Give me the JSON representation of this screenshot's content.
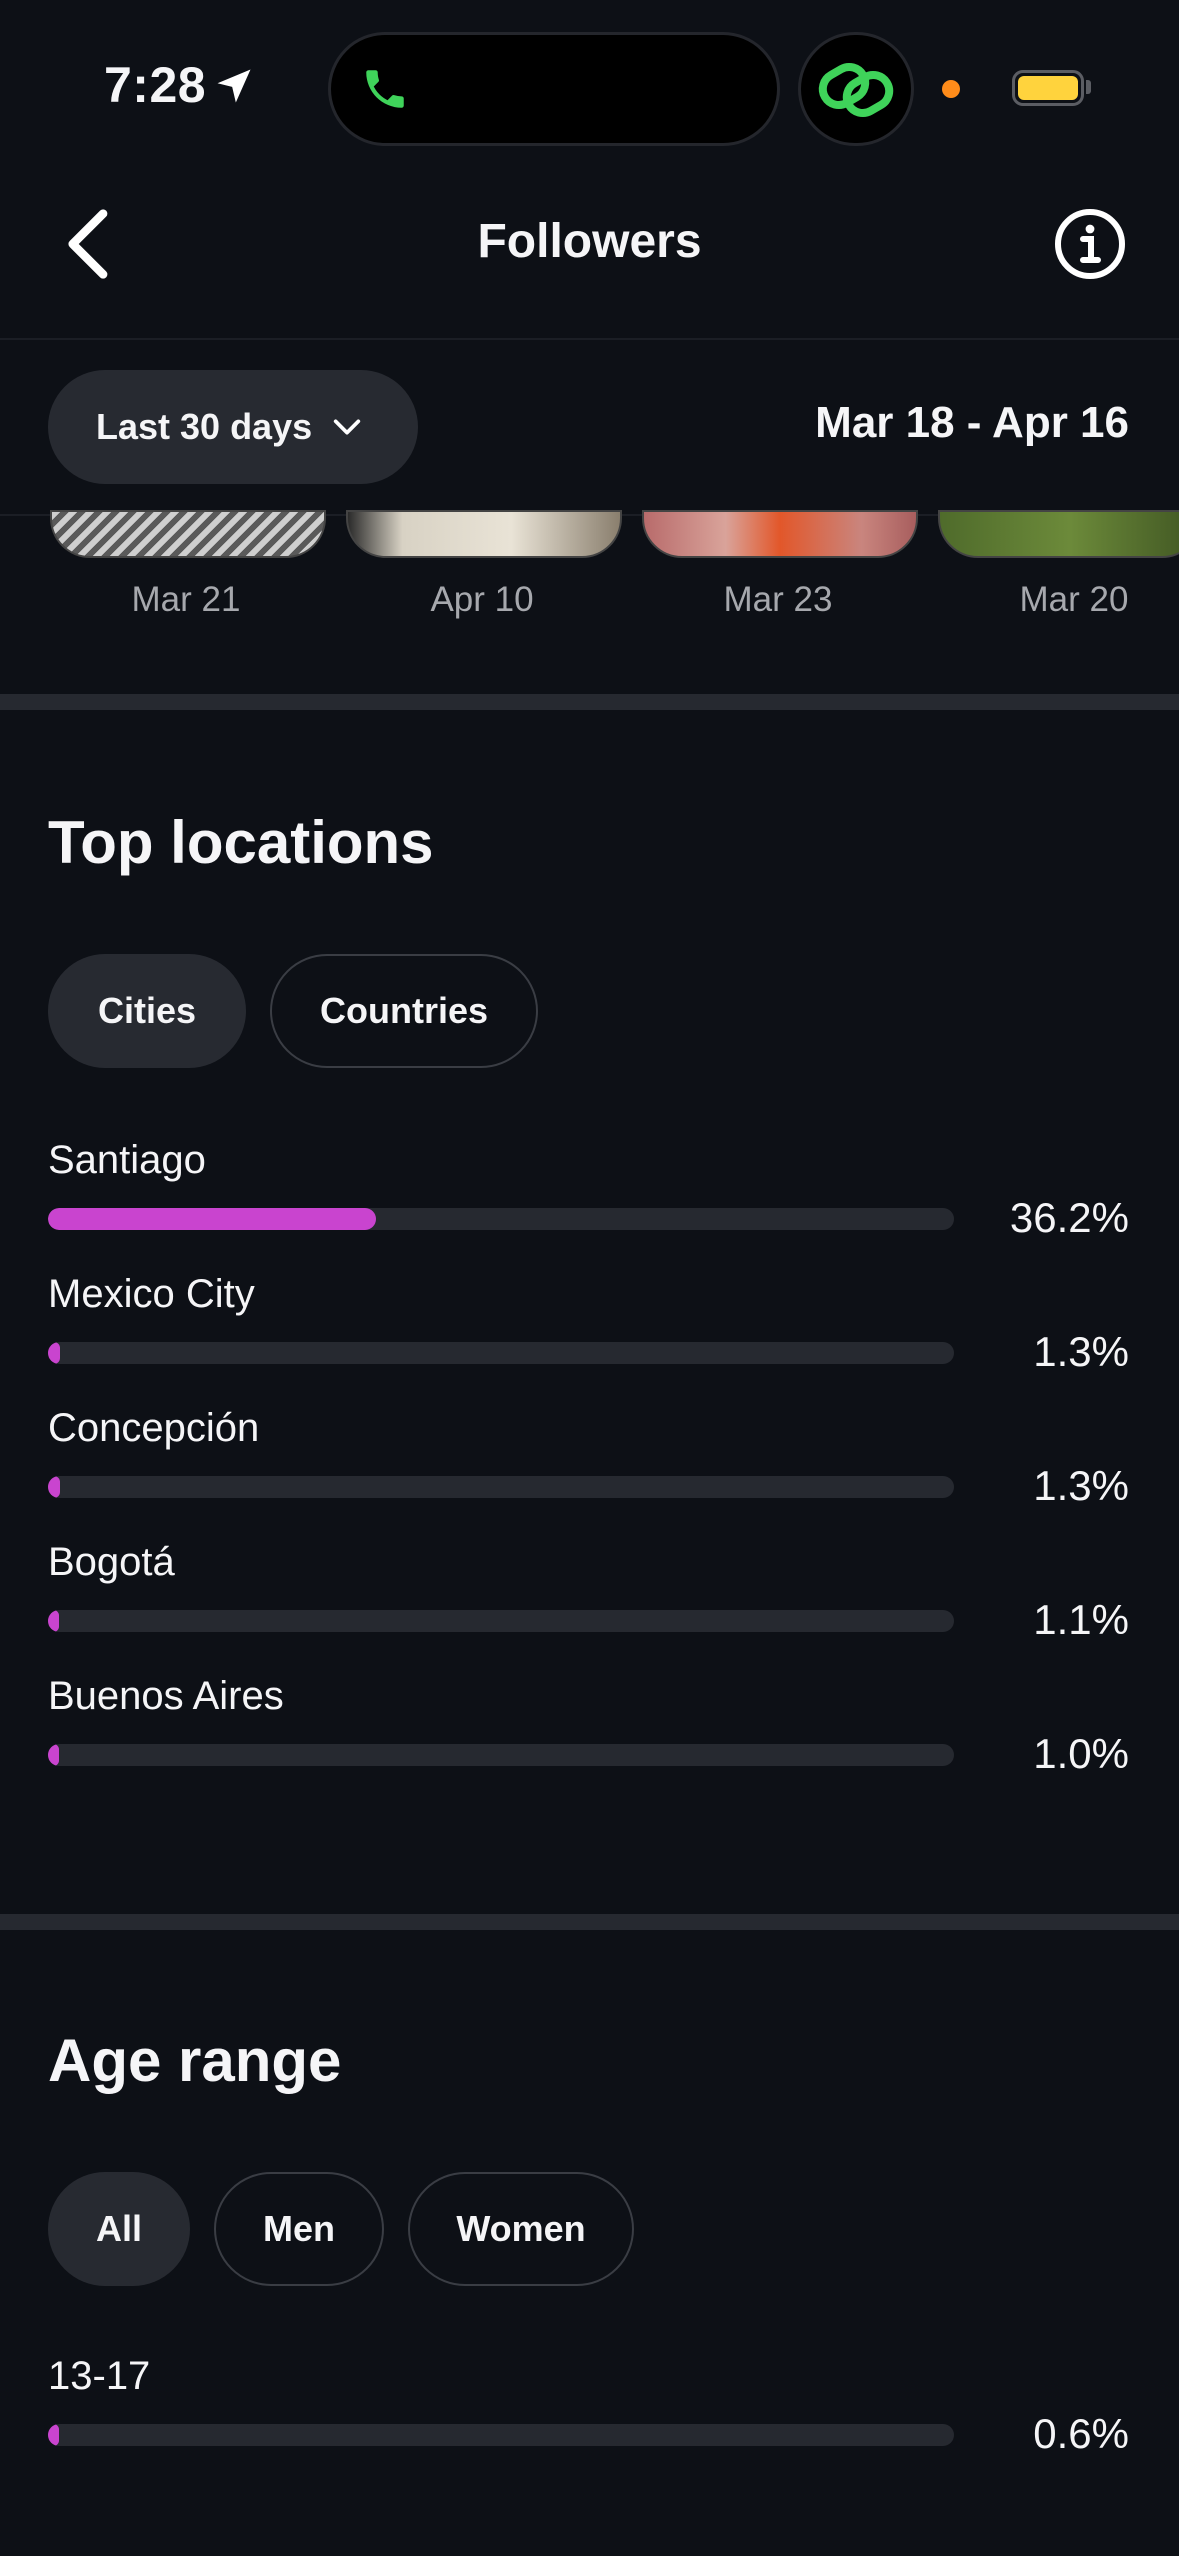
{
  "status_bar": {
    "time": "7:28"
  },
  "header": {
    "title": "Followers"
  },
  "filter": {
    "range_label": "Last 30 days",
    "date_range": "Mar 18 - Apr 16"
  },
  "thumbnails": [
    {
      "date": "Mar 21"
    },
    {
      "date": "Apr 10"
    },
    {
      "date": "Mar 23"
    },
    {
      "date": "Mar 20"
    }
  ],
  "top_locations": {
    "title": "Top locations",
    "tabs": [
      "Cities",
      "Countries"
    ],
    "active_tab": "Cities",
    "rows": [
      {
        "label": "Santiago",
        "percent": "36.2%",
        "value": 0.362
      },
      {
        "label": "Mexico City",
        "percent": "1.3%",
        "value": 0.013
      },
      {
        "label": "Concepción",
        "percent": "1.3%",
        "value": 0.013
      },
      {
        "label": "Bogotá",
        "percent": "1.1%",
        "value": 0.011
      },
      {
        "label": "Buenos Aires",
        "percent": "1.0%",
        "value": 0.01
      }
    ]
  },
  "age_range": {
    "title": "Age range",
    "tabs": [
      "All",
      "Men",
      "Women"
    ],
    "active_tab": "All",
    "rows": [
      {
        "label": "13-17",
        "percent": "0.6%",
        "value": 0.006
      }
    ]
  },
  "colors": {
    "accent": "#c944cf",
    "background": "#0d1016",
    "chip": "#272a31",
    "track": "#262930"
  }
}
